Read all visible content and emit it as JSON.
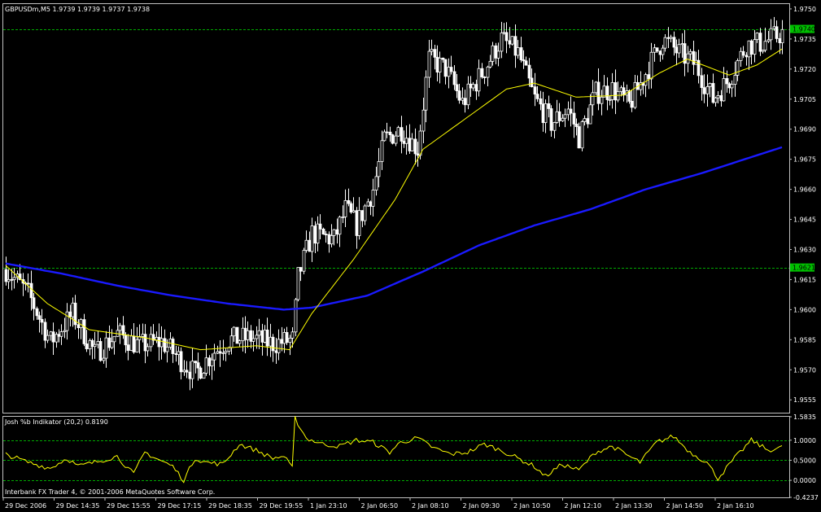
{
  "header": {
    "main_title": "GBPUSDm,M5  1.9739 1.9739 1.9737 1.9738",
    "sub_title": "Josh %b Indikator (20,2) 0.8190",
    "copyright": "Interbank FX Trader 4, © 2001-2006 MetaQuotes Software Corp."
  },
  "colors": {
    "background": "#000000",
    "frame": "#c0c0c0",
    "candle": "#ffffff",
    "ma_fast": "#ffff00",
    "ma_slow": "#1a1aff",
    "level_line": "#00aa00",
    "badge_bg": "#00c000",
    "badge_text": "#000000",
    "indicator_line": "#ffff00"
  },
  "chart_data": [
    {
      "type": "candlestick",
      "symbol": "GBPUSDm,M5",
      "ohlc_readout": "1.9739 1.9739 1.9737 1.9738",
      "y_ticks": [
        "1.9750",
        "1.9735",
        "1.9720",
        "1.9705",
        "1.9690",
        "1.9675",
        "1.9660",
        "1.9645",
        "1.9630",
        "1.9615",
        "1.9600",
        "1.9585",
        "1.9570",
        "1.9555"
      ],
      "ylim": [
        1.9549,
        1.9752
      ],
      "x_ticks": [
        "29 Dec 2006",
        "29 Dec 14:35",
        "29 Dec 15:55",
        "29 Dec 17:15",
        "29 Dec 18:35",
        "29 Dec 19:55",
        "1 Jan 23:10",
        "2 Jan 06:50",
        "2 Jan 08:10",
        "2 Jan 09:30",
        "2 Jan 10:50",
        "2 Jan 12:10",
        "2 Jan 13:30",
        "2 Jan 14:50",
        "2 Jan 16:10"
      ],
      "levels": [
        {
          "value": 1.974,
          "label": "1.9740"
        },
        {
          "value": 1.9621,
          "label": "1.9621"
        }
      ],
      "close_anchors": [
        [
          0,
          1.962
        ],
        [
          8,
          1.9608
        ],
        [
          16,
          1.9584
        ],
        [
          24,
          1.9598
        ],
        [
          32,
          1.9578
        ],
        [
          40,
          1.9588
        ],
        [
          48,
          1.9582
        ],
        [
          56,
          1.9584
        ],
        [
          62,
          1.9576
        ],
        [
          68,
          1.9568
        ],
        [
          74,
          1.9578
        ],
        [
          80,
          1.9585
        ],
        [
          88,
          1.9586
        ],
        [
          96,
          1.9583
        ],
        [
          103,
          1.9585
        ],
        [
          105,
          1.9616
        ],
        [
          110,
          1.9638
        ],
        [
          118,
          1.9635
        ],
        [
          122,
          1.965
        ],
        [
          126,
          1.9642
        ],
        [
          132,
          1.966
        ],
        [
          136,
          1.9685
        ],
        [
          142,
          1.969
        ],
        [
          148,
          1.968
        ],
        [
          152,
          1.9725
        ],
        [
          158,
          1.972
        ],
        [
          164,
          1.9703
        ],
        [
          172,
          1.972
        ],
        [
          178,
          1.9735
        ],
        [
          184,
          1.9728
        ],
        [
          190,
          1.9705
        ],
        [
          196,
          1.9693
        ],
        [
          202,
          1.97
        ],
        [
          206,
          1.9686
        ],
        [
          212,
          1.9708
        ],
        [
          218,
          1.971
        ],
        [
          224,
          1.9702
        ],
        [
          230,
          1.9718
        ],
        [
          236,
          1.9735
        ],
        [
          242,
          1.9728
        ],
        [
          248,
          1.9722
        ],
        [
          254,
          1.9705
        ],
        [
          260,
          1.9715
        ],
        [
          266,
          1.9732
        ],
        [
          272,
          1.9733
        ],
        [
          279,
          1.9738
        ]
      ],
      "ma_fast": [
        [
          0,
          1.9622
        ],
        [
          15,
          1.9603
        ],
        [
          30,
          1.959
        ],
        [
          50,
          1.9586
        ],
        [
          70,
          1.958
        ],
        [
          90,
          1.9582
        ],
        [
          102,
          1.958
        ],
        [
          110,
          1.9598
        ],
        [
          125,
          1.9625
        ],
        [
          140,
          1.9655
        ],
        [
          150,
          1.968
        ],
        [
          165,
          1.9695
        ],
        [
          180,
          1.971
        ],
        [
          190,
          1.9713
        ],
        [
          205,
          1.9706
        ],
        [
          222,
          1.9707
        ],
        [
          235,
          1.9718
        ],
        [
          245,
          1.9725
        ],
        [
          260,
          1.9717
        ],
        [
          270,
          1.9722
        ],
        [
          279,
          1.973
        ]
      ],
      "ma_slow": [
        [
          0,
          1.9623
        ],
        [
          20,
          1.9618
        ],
        [
          40,
          1.9612
        ],
        [
          60,
          1.9607
        ],
        [
          80,
          1.9603
        ],
        [
          100,
          1.96
        ],
        [
          110,
          1.9601
        ],
        [
          130,
          1.9607
        ],
        [
          150,
          1.9619
        ],
        [
          170,
          1.9632
        ],
        [
          190,
          1.9642
        ],
        [
          210,
          1.965
        ],
        [
          230,
          1.966
        ],
        [
          250,
          1.9668
        ],
        [
          279,
          1.9681
        ]
      ]
    },
    {
      "type": "line",
      "name": "Josh %b Indikator (20,2)",
      "current_value": "0.8190",
      "y_ticks": [
        "1.5835",
        "1.0000",
        "0.5000",
        "0.0000",
        "-0.4237"
      ],
      "ylim": [
        -0.4237,
        1.5835
      ],
      "levels": [
        1.0,
        0.5,
        0.0
      ],
      "x": [
        0,
        8,
        16,
        22,
        26,
        32,
        40,
        46,
        50,
        54,
        60,
        64,
        68,
        72,
        78,
        84,
        90,
        96,
        100,
        103,
        104,
        108,
        114,
        120,
        126,
        132,
        138,
        142,
        148,
        154,
        160,
        166,
        172,
        178,
        184,
        190,
        194,
        200,
        206,
        212,
        218,
        224,
        228,
        234,
        240,
        246,
        252,
        256,
        262,
        268,
        274,
        279
      ],
      "values": [
        0.65,
        0.45,
        0.3,
        0.55,
        0.35,
        0.45,
        0.6,
        0.15,
        0.7,
        0.55,
        0.35,
        0.0,
        0.55,
        0.45,
        0.4,
        0.9,
        0.75,
        0.55,
        0.6,
        0.3,
        1.55,
        1.05,
        0.9,
        0.85,
        1.0,
        0.95,
        0.7,
        0.95,
        1.05,
        0.8,
        0.65,
        0.7,
        0.9,
        0.75,
        0.55,
        0.35,
        0.1,
        0.4,
        0.25,
        0.7,
        0.85,
        0.6,
        0.45,
        0.95,
        1.1,
        0.7,
        0.45,
        0.05,
        0.55,
        1.0,
        0.75,
        0.82
      ]
    }
  ]
}
